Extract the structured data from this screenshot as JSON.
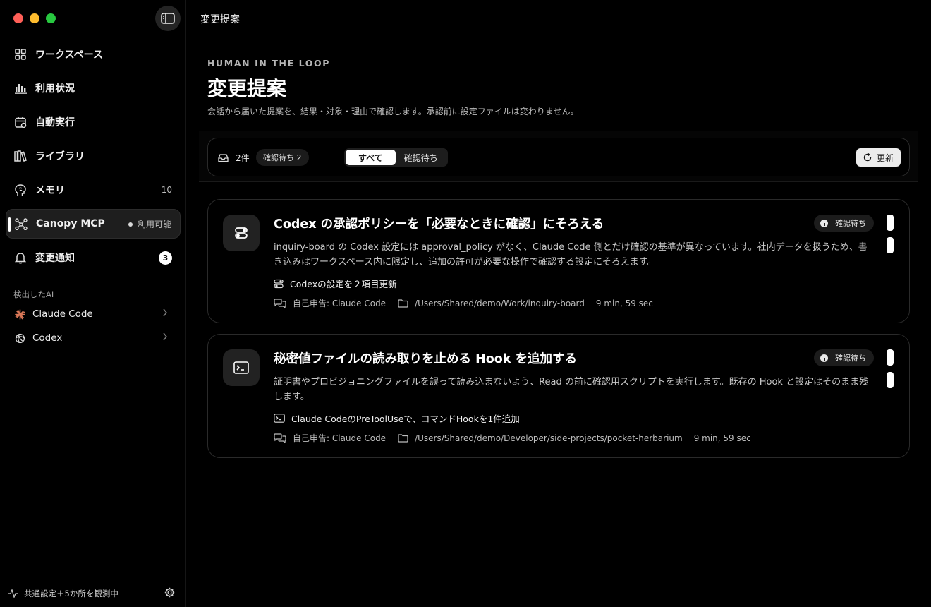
{
  "window": {
    "title": "変更提案"
  },
  "sidebar": {
    "nav": [
      {
        "label": "ワークスペース",
        "icon": "grid-icon",
        "right": ""
      },
      {
        "label": "利用状況",
        "icon": "bar-chart-icon",
        "right": ""
      },
      {
        "label": "自動実行",
        "icon": "calendar-icon",
        "right": ""
      },
      {
        "label": "ライブラリ",
        "icon": "library-icon",
        "right": ""
      },
      {
        "label": "メモリ",
        "icon": "brain-icon",
        "right": "10"
      },
      {
        "label": "Canopy MCP",
        "icon": "mcp-icon",
        "right": "利用可能",
        "active": true
      },
      {
        "label": "変更通知",
        "icon": "bell-icon",
        "badge": "3"
      }
    ],
    "detected_label": "検出したAI",
    "ai_items": [
      {
        "label": "Claude Code",
        "icon": "claude-icon",
        "color": "#d97757"
      },
      {
        "label": "Codex",
        "icon": "openai-icon"
      }
    ],
    "footer": {
      "status": "共通設定＋5か所を観測中"
    }
  },
  "header": {
    "eyebrow": "HUMAN IN THE LOOP",
    "title": "変更提案",
    "subtitle": "会話から届いた提案を、結果・対象・理由で確認します。承認前に設定ファイルは変わりません。"
  },
  "toolbar": {
    "count": "2件",
    "pending_chip": "確認待ち 2",
    "filters": [
      {
        "label": "すべて",
        "selected": true
      },
      {
        "label": "確認待ち",
        "selected": false
      }
    ],
    "refresh_label": "更新"
  },
  "proposals": [
    {
      "icon": "toggles-icon",
      "title": "Codex の承認ポリシーを「必要なときに確認」にそろえる",
      "status": "確認待ち",
      "description": "inquiry-board の Codex 設定には approval_policy がなく、Claude Code 側とだけ確認の基準が異なっています。社内データを扱うため、書き込みはワークスペース内に限定し、追加の許可が必要な操作で確認する設定にそろえます。",
      "change": "Codexの設定を２項目更新",
      "source": "自己申告: Claude Code",
      "path": "/Users/Shared/demo/Work/inquiry-board",
      "elapsed": "9 min, 59 sec"
    },
    {
      "icon": "terminal-icon",
      "title": "秘密値ファイルの読み取りを止める Hook を追加する",
      "status": "確認待ち",
      "description": "証明書やプロビジョニングファイルを誤って読み込まないよう、Read の前に確認用スクリプトを実行します。既存の Hook と設定はそのまま残します。",
      "change": "Claude CodeのPreToolUseで、コマンドHookを1件追加",
      "source": "自己申告: Claude Code",
      "path": "/Users/Shared/demo/Developer/side-projects/pocket-herbarium",
      "elapsed": "9 min, 59 sec"
    }
  ],
  "colors": {
    "close": "#ff5f57",
    "minimize": "#febc2e",
    "zoom": "#28c840",
    "claude": "#d97757"
  }
}
